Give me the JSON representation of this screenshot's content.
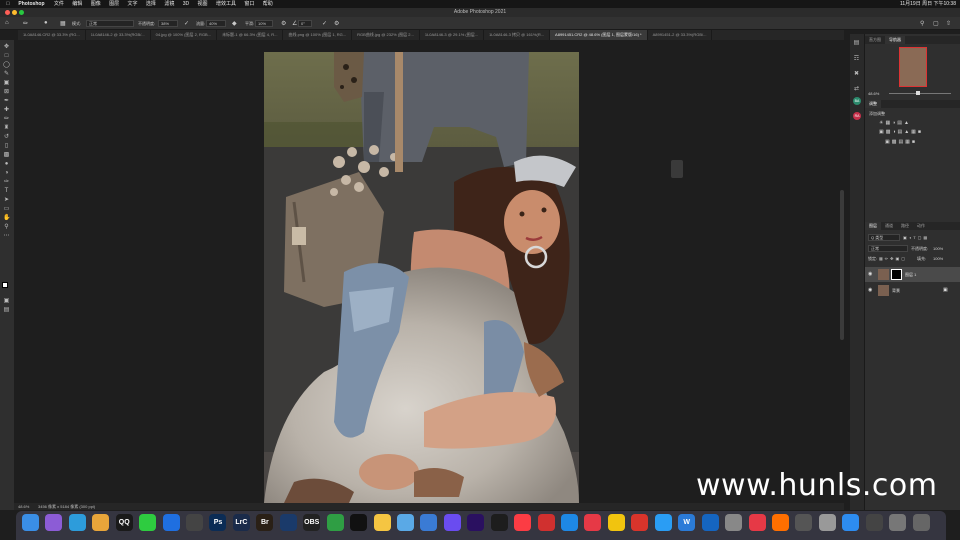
{
  "menubar": {
    "app_name": "Photoshop",
    "items": [
      "文件",
      "编辑",
      "图像",
      "图层",
      "文字",
      "选择",
      "滤镜",
      "3D",
      "视图",
      "增效工具",
      "窗口",
      "帮助"
    ],
    "status_right": "11月19日 周日 下午10:38"
  },
  "window": {
    "title": "Adobe Photoshop 2021"
  },
  "options_bar": {
    "mode_label": "模式:",
    "mode_value": "正常",
    "opacity_label": "不透明度:",
    "opacity_value": "38%",
    "flow_label": "流量:",
    "flow_value": "40%",
    "smooth_label": "平滑:",
    "smooth_value": "10%",
    "angle_value": "0°"
  },
  "tabs": [
    {
      "label": "1L0A8146.CR2 @ 33.3% (RG..."
    },
    {
      "label": "1L0A8146-2 @ 33.3%(RGB/..."
    },
    {
      "label": "04.jpg @ 100% (图层 2, RGB..."
    },
    {
      "label": "未标题-1 @ 66.3% (图层 4, R..."
    },
    {
      "label": "曲线.png @ 100% (图层 1, RG..."
    },
    {
      "label": "RGB曲线.jpg @ 232% (图层 2..."
    },
    {
      "label": "1L0A8146-3 @ 29.1% (图层..."
    },
    {
      "label": "1L0A8146-3 拷贝 @ 161%(R..."
    },
    {
      "label": "A8991451.CR2 @ 48.6% (图层 1, 图层蒙版/16) *",
      "active": true
    },
    {
      "label": "A8991451-2 @ 33.3%(RGB/..."
    }
  ],
  "status": {
    "zoom": "48.6%",
    "doc_info": "3456 像素 x 5184 像素 (300 ppi)"
  },
  "navigator": {
    "tabs": [
      "直方图",
      "导航器"
    ],
    "active_tab": "导航器",
    "zoom": "48.6%"
  },
  "adjustments": {
    "tabs": [
      "调整"
    ],
    "subtitle": "添加调整"
  },
  "layers_panel": {
    "tabs": [
      "图层",
      "通道",
      "路径",
      "动作"
    ],
    "kind_label": "Q 类型",
    "blend_mode": "正常",
    "opacity_label": "不透明度:",
    "opacity_value": "100%",
    "lock_label": "锁定:",
    "fill_label": "填充:",
    "fill_value": "100%",
    "layers": [
      {
        "name": "图层 1",
        "has_mask": true,
        "selected": true
      },
      {
        "name": "背景",
        "locked": true
      }
    ]
  },
  "dock": {
    "apps": [
      "Finder",
      "Launchpad",
      "Safari",
      "Chrome",
      "QQ",
      "WeChat",
      "Tencent Meeting",
      "Camera",
      "Ps",
      "LrC",
      "Br",
      "Lightroom",
      "OBS",
      "Numbers",
      "Capcut",
      "Photos",
      "Preview",
      "Keynote",
      "Final Cut",
      "Premiere",
      "Cinema",
      "Music",
      "Netease",
      "App Store",
      "Weibo",
      "Game",
      "Video",
      "Messenger",
      "W",
      "Xcode",
      "Settings",
      "Creative Cloud",
      "Illustrator",
      "Screen",
      "Compressor",
      "Files",
      "Screenshot",
      "Music2",
      "Trash"
    ]
  },
  "watermark": "www.hunls.com",
  "colors": {
    "accent": "#2c6ad8",
    "panel_bg": "#2f2f2f",
    "canvas_bg": "#1e1e1e"
  }
}
